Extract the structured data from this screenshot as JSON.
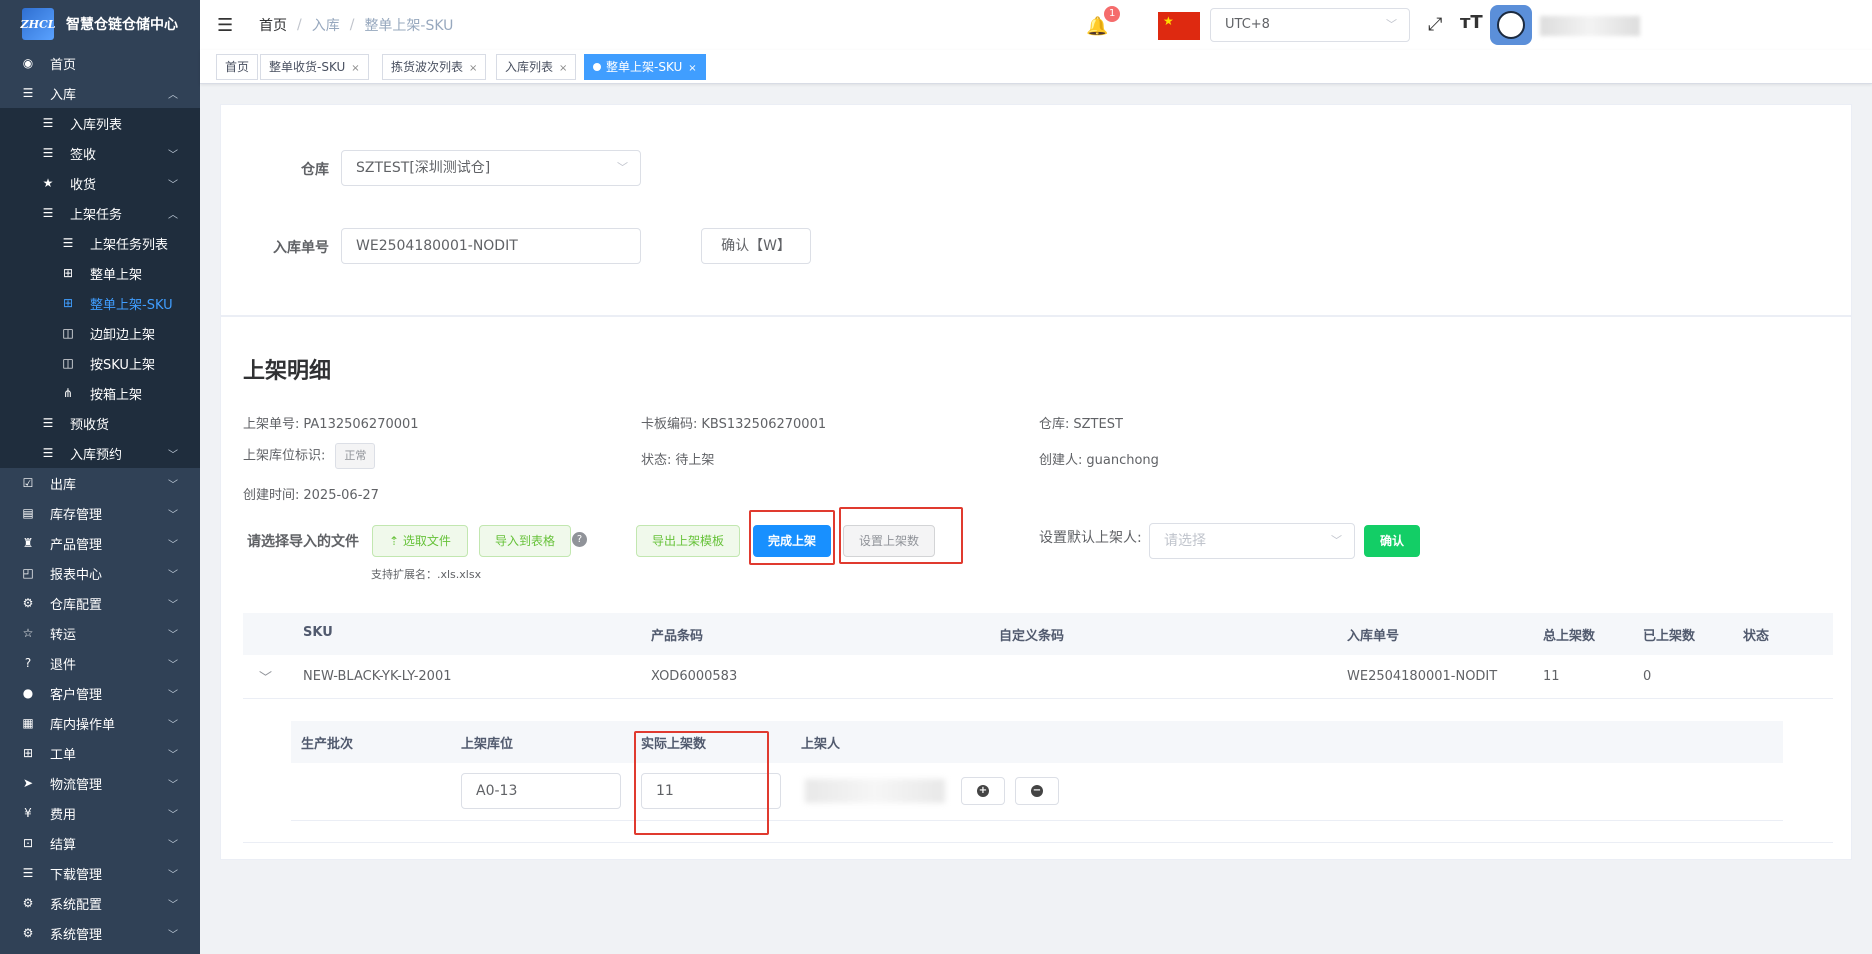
{
  "app": {
    "name": "智慧仓链仓储中心",
    "logo_text": "ZHCL"
  },
  "sidebar": {
    "items": [
      {
        "label": "首页",
        "icon": "dashboard-icon",
        "level": 1
      },
      {
        "label": "入库",
        "icon": "list-icon",
        "level": 1,
        "expanded": true
      },
      {
        "label": "入库列表",
        "icon": "list-icon",
        "level": 2
      },
      {
        "label": "签收",
        "icon": "list-icon",
        "level": 2
      },
      {
        "label": "收货",
        "icon": "star-icon",
        "level": 2
      },
      {
        "label": "上架任务",
        "icon": "list-icon",
        "level": 2,
        "expanded": true
      },
      {
        "label": "上架任务列表",
        "icon": "list-icon",
        "level": 3
      },
      {
        "label": "整单上架",
        "icon": "grid-icon",
        "level": 3
      },
      {
        "label": "整单上架-SKU",
        "icon": "grid-icon",
        "level": 3,
        "active": true
      },
      {
        "label": "边卸边上架",
        "icon": "panel-icon",
        "level": 3
      },
      {
        "label": "按SKU上架",
        "icon": "panel-icon",
        "level": 3
      },
      {
        "label": "按箱上架",
        "icon": "tree-icon",
        "level": 3
      },
      {
        "label": "预收货",
        "icon": "list-icon",
        "level": 2
      },
      {
        "label": "入库预约",
        "icon": "list-icon",
        "level": 2
      },
      {
        "label": "出库",
        "icon": "checkbox-icon",
        "level": 1
      },
      {
        "label": "库存管理",
        "icon": "box-icon",
        "level": 1
      },
      {
        "label": "产品管理",
        "icon": "shirt-icon",
        "level": 1
      },
      {
        "label": "报表中心",
        "icon": "chart-icon",
        "level": 1
      },
      {
        "label": "仓库配置",
        "icon": "gear-icon",
        "level": 1
      },
      {
        "label": "转运",
        "icon": "star-outline-icon",
        "level": 1
      },
      {
        "label": "退件",
        "icon": "question-icon",
        "level": 1
      },
      {
        "label": "客户管理",
        "icon": "user-icon",
        "level": 1
      },
      {
        "label": "库内操作单",
        "icon": "doc-icon",
        "level": 1
      },
      {
        "label": "工单",
        "icon": "grid-icon",
        "level": 1
      },
      {
        "label": "物流管理",
        "icon": "plane-icon",
        "level": 1
      },
      {
        "label": "费用",
        "icon": "yen-icon",
        "level": 1
      },
      {
        "label": "结算",
        "icon": "settle-icon",
        "level": 1
      },
      {
        "label": "下载管理",
        "icon": "list-icon",
        "level": 1
      },
      {
        "label": "系统配置",
        "icon": "gear-icon",
        "level": 1
      },
      {
        "label": "系统管理",
        "icon": "gear-icon",
        "level": 1
      }
    ]
  },
  "header": {
    "breadcrumb": [
      "首页",
      "入库",
      "整单上架-SKU"
    ],
    "notification_count": "1",
    "timezone": "UTC+8"
  },
  "tabs": [
    {
      "label": "首页",
      "closable": false
    },
    {
      "label": "整单收货-SKU",
      "closable": true
    },
    {
      "label": "拣货波次列表",
      "closable": true
    },
    {
      "label": "入库列表",
      "closable": true
    },
    {
      "label": "整单上架-SKU",
      "closable": true,
      "active": true
    }
  ],
  "form": {
    "warehouse_label": "仓库",
    "warehouse_value": "SZTEST[深圳测试仓]",
    "inbound_label": "入库单号",
    "inbound_value": "WE2504180001-NODIT",
    "confirm_button": "确认【W】"
  },
  "detail": {
    "title": "上架明细",
    "putaway_no_label": "上架单号:",
    "putaway_no": "PA132506270001",
    "pallet_label": "卡板编码:",
    "pallet": "KBS132506270001",
    "warehouse_label": "仓库:",
    "warehouse": "SZTEST",
    "location_flag_label": "上架库位标识:",
    "location_flag": "正常",
    "status_label": "状态:",
    "status": "待上架",
    "creator_label": "创建人:",
    "creator": "guanchong",
    "created_label": "创建时间:",
    "created": "2025-06-27"
  },
  "actions": {
    "file_label": "请选择导入的文件",
    "select_file": "选取文件",
    "import_table": "导入到表格",
    "ext_hint": "支持扩展名：.xls.xlsx",
    "export_template": "导出上架模板",
    "complete_putaway": "完成上架",
    "set_putaway_qty": "设置上架数",
    "default_user_label": "设置默认上架人:",
    "default_user_placeholder": "请选择",
    "confirm": "确认"
  },
  "table": {
    "columns": [
      "SKU",
      "产品条码",
      "自定义条码",
      "入库单号",
      "总上架数",
      "已上架数",
      "状态"
    ],
    "rows": [
      {
        "sku": "NEW-BLACK-YK-LY-2001",
        "barcode": "XOD6000583",
        "custom": "",
        "inbound": "WE2504180001-NODIT",
        "total": "11",
        "done": "0",
        "status": ""
      }
    ],
    "sub_columns": [
      "生产批次",
      "上架库位",
      "实际上架数",
      "上架人"
    ],
    "sub_rows": [
      {
        "batch": "",
        "location": "A0-13",
        "qty": "11"
      }
    ]
  }
}
